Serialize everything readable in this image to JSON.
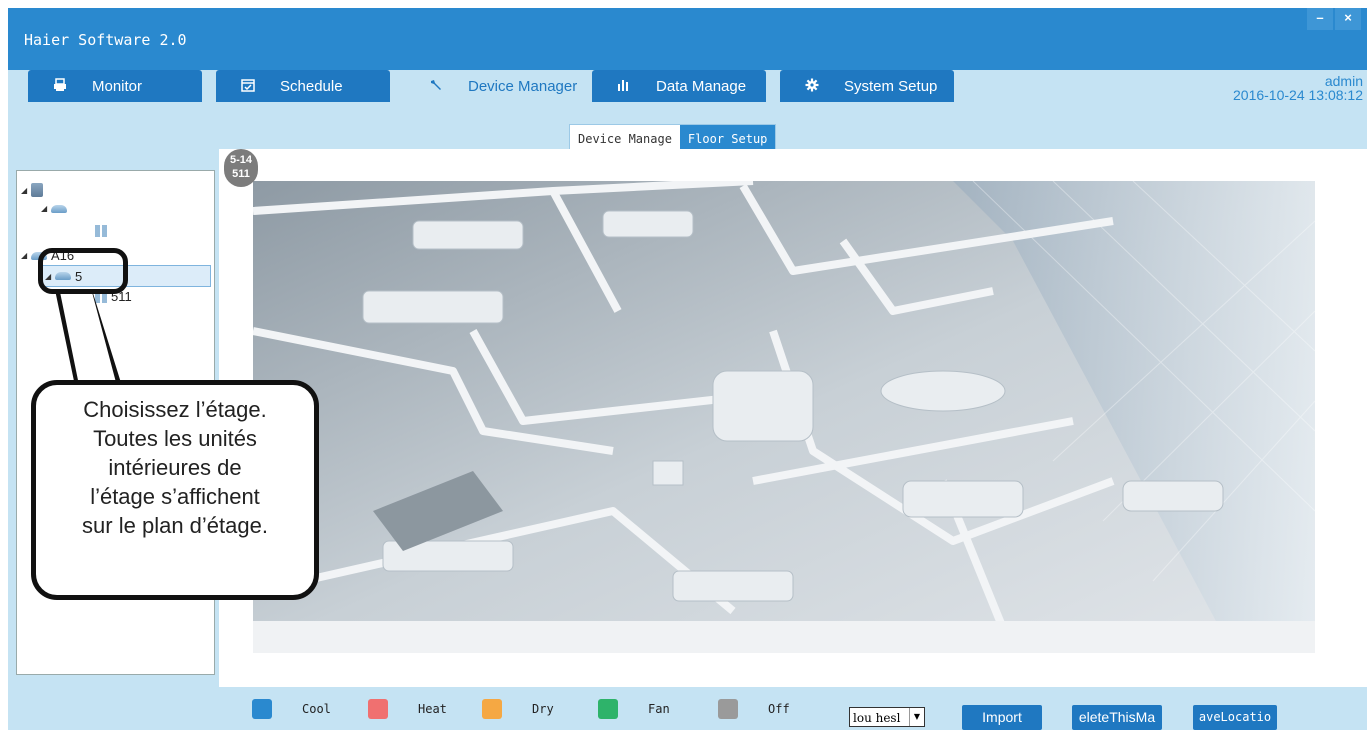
{
  "app": {
    "title": "Haier Software 2.0",
    "minimize_label": "–",
    "close_label": "×",
    "user": "admin",
    "datetime": "2016-10-24 13:08:12"
  },
  "tabs": [
    {
      "label": "Monitor",
      "icon": "printer-icon"
    },
    {
      "label": "Schedule",
      "icon": "calendar-icon"
    },
    {
      "label": "Device Manager",
      "icon": "wrench-icon",
      "active": true
    },
    {
      "label": "Data Manage",
      "icon": "bar-chart-icon"
    },
    {
      "label": "System Setup",
      "icon": "gear-icon"
    }
  ],
  "subtabs": [
    {
      "label": "Device Manage"
    },
    {
      "label": "Floor Setup",
      "active": true
    }
  ],
  "tree": {
    "node_building_2": "A16",
    "node_floor_selected": "5",
    "node_room": "511"
  },
  "floorplan": {
    "badge_line1": "5-14",
    "badge_line2": "511"
  },
  "legend": [
    {
      "label": "Cool",
      "color": "#2a89cf"
    },
    {
      "label": "Heat",
      "color": "#f07070"
    },
    {
      "label": "Dry",
      "color": "#f5a843"
    },
    {
      "label": "Fan",
      "color": "#2eb36a"
    },
    {
      "label": "Off",
      "color": "#9a9a9a"
    }
  ],
  "actions": {
    "floor_select_value": "lou hesl",
    "import_label": "Import",
    "delete_label": "eleteThisMa",
    "save_label": "aveLocatio"
  },
  "callout": {
    "line1": "Choisissez l’étage.",
    "line2": "Toutes les unités",
    "line3": "intérieures de",
    "line4": "l’étage s’affichent",
    "line5": "sur le plan d’étage."
  }
}
